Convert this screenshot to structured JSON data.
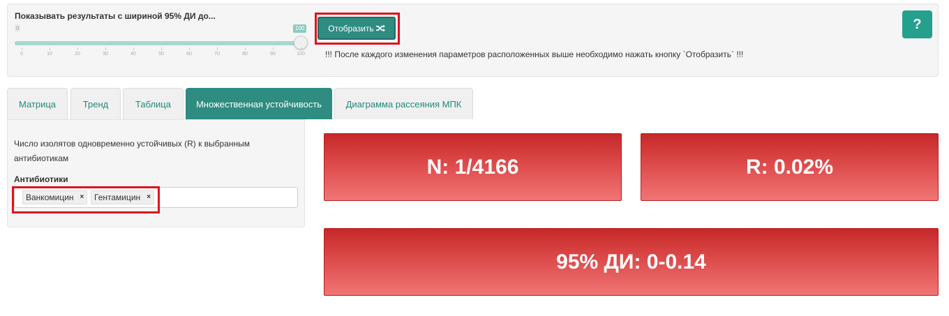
{
  "params": {
    "slider_label": "Показывать результаты с шириной 95% ДИ до...",
    "slider": {
      "min_label": "0",
      "max_label": "100",
      "value": 100,
      "min": 0,
      "max": 100,
      "ticks": [
        "0",
        "10",
        "20",
        "30",
        "40",
        "50",
        "60",
        "70",
        "80",
        "90",
        "100"
      ]
    },
    "show_button_label": "Отобразить",
    "hint": "!!! После каждого изменения параметров расположенных выше необходимо нажать кнопку `Отобразить` !!!",
    "help_label": "?"
  },
  "tabs": [
    {
      "label": "Матрица",
      "active": false
    },
    {
      "label": "Тренд",
      "active": false
    },
    {
      "label": "Таблица",
      "active": false
    },
    {
      "label": "Множественная устойчивость",
      "active": true
    },
    {
      "label": "Диаграмма рассеяния МПК",
      "active": false
    }
  ],
  "sidebar": {
    "description": "Число изолятов одновременно устойчивых (R) к выбранным антибиотикам",
    "field_label": "Антибиотики",
    "chips": [
      {
        "label": "Ванкомицин",
        "remove": "×"
      },
      {
        "label": "Гентамицин",
        "remove": "×"
      }
    ]
  },
  "results": {
    "n": "N: 1/4166",
    "r": "R: 0.02%",
    "ci": "95% ДИ: 0-0.14"
  },
  "colors": {
    "accent": "#2e8c81",
    "help": "#24a08c",
    "highlight_frame": "#e0111b",
    "value_box_top": "#c62828",
    "value_box_bottom": "#f07575"
  }
}
